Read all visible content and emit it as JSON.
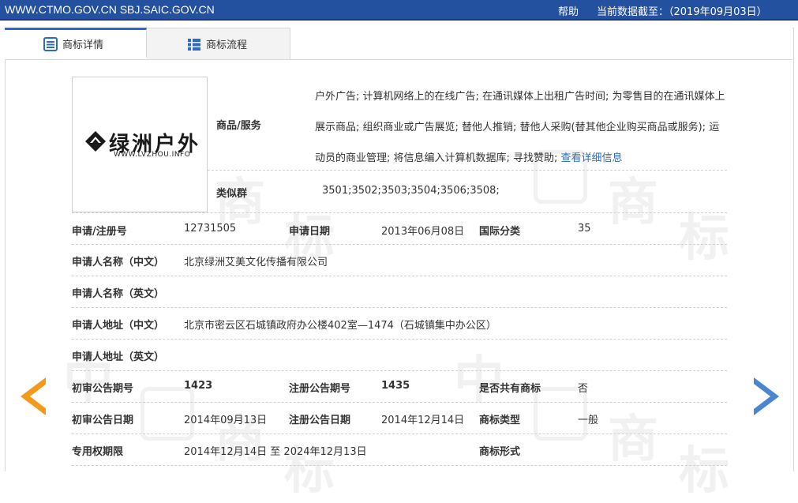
{
  "topbar": {
    "site": "WWW.CTMO.GOV.CN SBJ.SAIC.GOV.CN",
    "help": "帮助",
    "asof": "当前数据截至：（2019年09月03日）"
  },
  "tabs": {
    "detail": "商标详情",
    "process": "商标流程"
  },
  "watermark": [
    "中",
    "国",
    "商",
    "标"
  ],
  "logo": {
    "text": "绿洲户外",
    "url": "WWW.LVZHOU.INFO"
  },
  "goods": {
    "label": "商品/服务",
    "text": "户外广告; 计算机网络上的在线广告; 在通讯媒体上出租广告时间; 为零售目的在通讯媒体上展示商品; 组织商业或广告展览; 替他人推销; 替他人采购(替其他企业购买商品或服务); 运动员的商业管理; 将信息编入计算机数据库; 寻找赞助;",
    "more_link": "查看详细信息"
  },
  "similar": {
    "label": "类似群",
    "value": "3501;3502;3503;3504;3506;3508;"
  },
  "fields": {
    "reg_no_label": "申请/注册号",
    "reg_no": "12731505",
    "app_date_label": "申请日期",
    "app_date": "2013年06月08日",
    "intl_class_label": "国际分类",
    "intl_class": "35",
    "applicant_cn_label": "申请人名称（中文）",
    "applicant_cn": "北京绿洲艾美文化传播有限公司",
    "applicant_en_label": "申请人名称（英文）",
    "applicant_en": "",
    "address_cn_label": "申请人地址（中文）",
    "address_cn": "北京市密云区石城镇政府办公楼402室—1474（石城镇集中办公区）",
    "address_en_label": "申请人地址（英文）",
    "address_en": "",
    "prelim_no_label": "初审公告期号",
    "prelim_no": "1423",
    "reg_pub_no_label": "注册公告期号",
    "reg_pub_no": "1435",
    "shared_label": "是否共有商标",
    "shared": "否",
    "prelim_date_label": "初审公告日期",
    "prelim_date": "2014年09月13日",
    "reg_pub_date_label": "注册公告日期",
    "reg_pub_date": "2014年12月14日",
    "tm_type_label": "商标类型",
    "tm_type": "一般",
    "period_label": "专用权期限",
    "period": "2014年12月14日 至 2024年12月13日",
    "tm_form_label": "商标形式",
    "tm_form": ""
  },
  "colors": {
    "topbar": "#2450a0",
    "tab_accent": "#2d69c8",
    "prev_arrow": "#f39a1d",
    "next_arrow": "#4a86cf",
    "link": "#2a6bc2"
  },
  "icons": {
    "detail_tab": "document-list-icon",
    "process_tab": "list-icon",
    "prev": "chevron-left-icon",
    "next": "chevron-right-icon"
  }
}
